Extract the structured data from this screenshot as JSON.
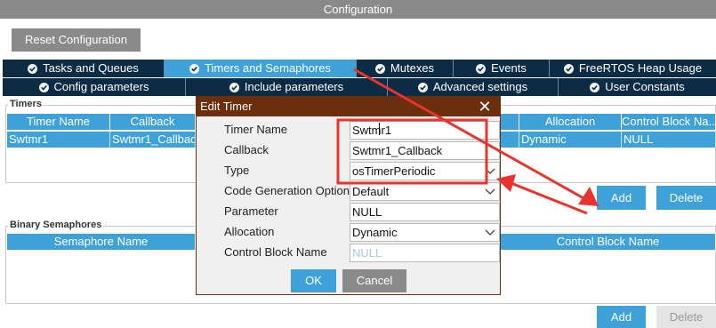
{
  "header": {
    "title": "Configuration"
  },
  "reset_button": "Reset Configuration",
  "tabs_row1": [
    "Tasks and Queues",
    "Timers and Semaphores",
    "Mutexes",
    "Events",
    "FreeRTOS Heap Usage"
  ],
  "tabs_row2": [
    "Config parameters",
    "Include parameters",
    "Advanced settings",
    "User Constants"
  ],
  "timers": {
    "group_label": "Timers",
    "columns": [
      "Timer Name",
      "Callback",
      "Allocation",
      "Control Block Na..."
    ],
    "row": {
      "name": "Swtmr1",
      "callback": "Swtmr1_Callbac",
      "allocation": "Dynamic",
      "control_block": "NULL"
    },
    "add_label": "Add",
    "delete_label": "Delete"
  },
  "binary_semaphores": {
    "group_label": "Binary Semaphores",
    "columns": [
      "Semaphore Name",
      "Control Block Name"
    ],
    "add_label": "Add",
    "delete_label": "Delete"
  },
  "dialog": {
    "title": "Edit Timer",
    "close": "✕",
    "fields": [
      {
        "label": "Timer Name",
        "value": "Swtmr1"
      },
      {
        "label": "Callback",
        "value": "Swtmr1_Callback"
      },
      {
        "label": "Type",
        "value": "osTimerPeriodic"
      },
      {
        "label": "Code Generation Option",
        "value": "Default"
      },
      {
        "label": "Parameter",
        "value": "NULL"
      },
      {
        "label": "Allocation",
        "value": "Dynamic"
      },
      {
        "label": "Control Block Name",
        "value": "NULL"
      }
    ],
    "ok_label": "OK",
    "cancel_label": "Cancel"
  },
  "colors": {
    "accent": "#3ea2d8",
    "tab_dark": "#0c2c45",
    "dialog_title": "#6b2f0e",
    "annotation": "#e8332e"
  }
}
